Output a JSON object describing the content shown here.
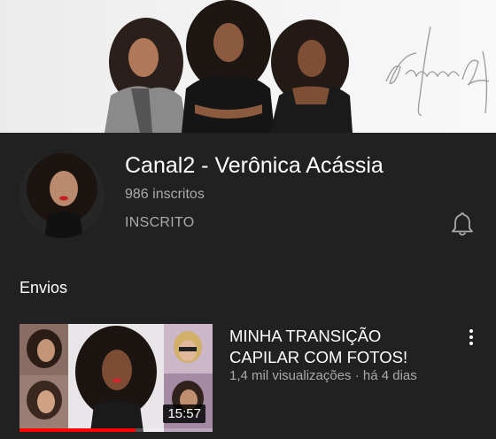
{
  "colors": {
    "background": "#212121",
    "primary_text": "#ffffff",
    "secondary_text": "#aaaaaa",
    "progress": "#ff0000"
  },
  "banner": {
    "signature_text": "Verônica Acássia"
  },
  "channel": {
    "name": "Canal2 - Verônica Acássia",
    "subscribers": "986 inscritos",
    "subscribed_label": "INSCRITO",
    "bell_icon": "bell-icon"
  },
  "section": {
    "title": "Envios"
  },
  "videos": [
    {
      "title": "MINHA TRANSIÇÃO CAPILAR COM FOTOS!",
      "meta": "1,4 mil visualizações · há 4 dias",
      "duration": "15:57",
      "watched_fraction": 0.6,
      "more_icon": "more-vert-icon"
    }
  ]
}
